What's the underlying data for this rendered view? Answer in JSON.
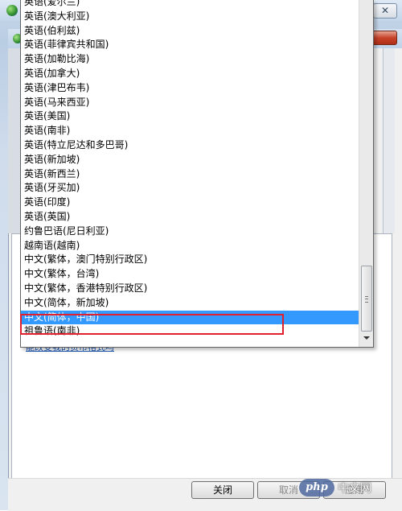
{
  "dropdown": {
    "items": [
      "英语(爱尔兰)",
      "英语(澳大利亚)",
      "英语(伯利兹)",
      "英语(菲律宾共和国)",
      "英语(加勒比海)",
      "英语(加拿大)",
      "英语(津巴布韦)",
      "英语(马来西亚)",
      "英语(美国)",
      "英语(南非)",
      "英语(特立尼达和多巴哥)",
      "英语(新加坡)",
      "英语(新西兰)",
      "英语(牙买加)",
      "英语(印度)",
      "英语(英国)",
      "约鲁巴语(尼日利亚)",
      "越南语(越南)",
      "中文(繁体，澳门特别行政区)",
      "中文(繁体，台湾)",
      "中文(繁体，香港特别行政区)",
      "中文(简体，新加坡)",
      "中文(简体，中国)",
      "祖鲁语(南非)"
    ],
    "selected": "中文(简体，中国)"
  },
  "buttons": {
    "close_label": "关闭",
    "cancel_label": "取消",
    "apply_label": "应用"
  },
  "link": {
    "text": "能改变我的货币格式吗"
  },
  "background_window": {
    "close_glyph": "✕"
  },
  "watermark": {
    "logo": "php",
    "text": "中文网"
  },
  "colors": {
    "selection": "#3399ff",
    "highlight_box": "#e0212d"
  }
}
